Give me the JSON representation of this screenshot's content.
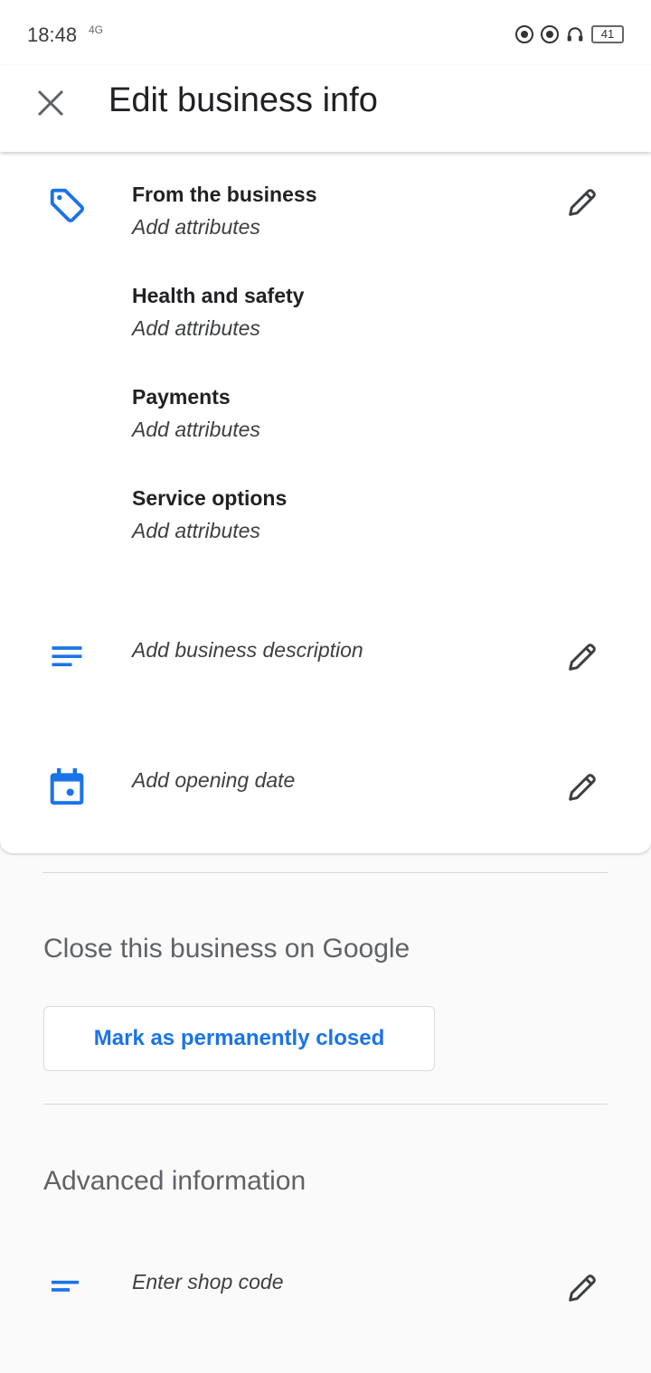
{
  "status_bar": {
    "time": "18:48",
    "network": "4G",
    "battery": "41"
  },
  "header": {
    "title": "Edit business info"
  },
  "attributes": [
    {
      "title": "From the business",
      "subtitle": "Add attributes"
    },
    {
      "title": "Health and safety",
      "subtitle": "Add attributes"
    },
    {
      "title": "Payments",
      "subtitle": "Add attributes"
    },
    {
      "title": "Service options",
      "subtitle": "Add attributes"
    }
  ],
  "description": {
    "placeholder": "Add business description"
  },
  "opening_date": {
    "placeholder": "Add opening date"
  },
  "close_section": {
    "title": "Close this business on Google",
    "button_label": "Mark as permanently closed"
  },
  "advanced_section": {
    "title": "Advanced information",
    "shop_code_placeholder": "Enter shop code"
  },
  "colors": {
    "accent": "#1a73e8",
    "icon_grey": "#3c4043"
  }
}
